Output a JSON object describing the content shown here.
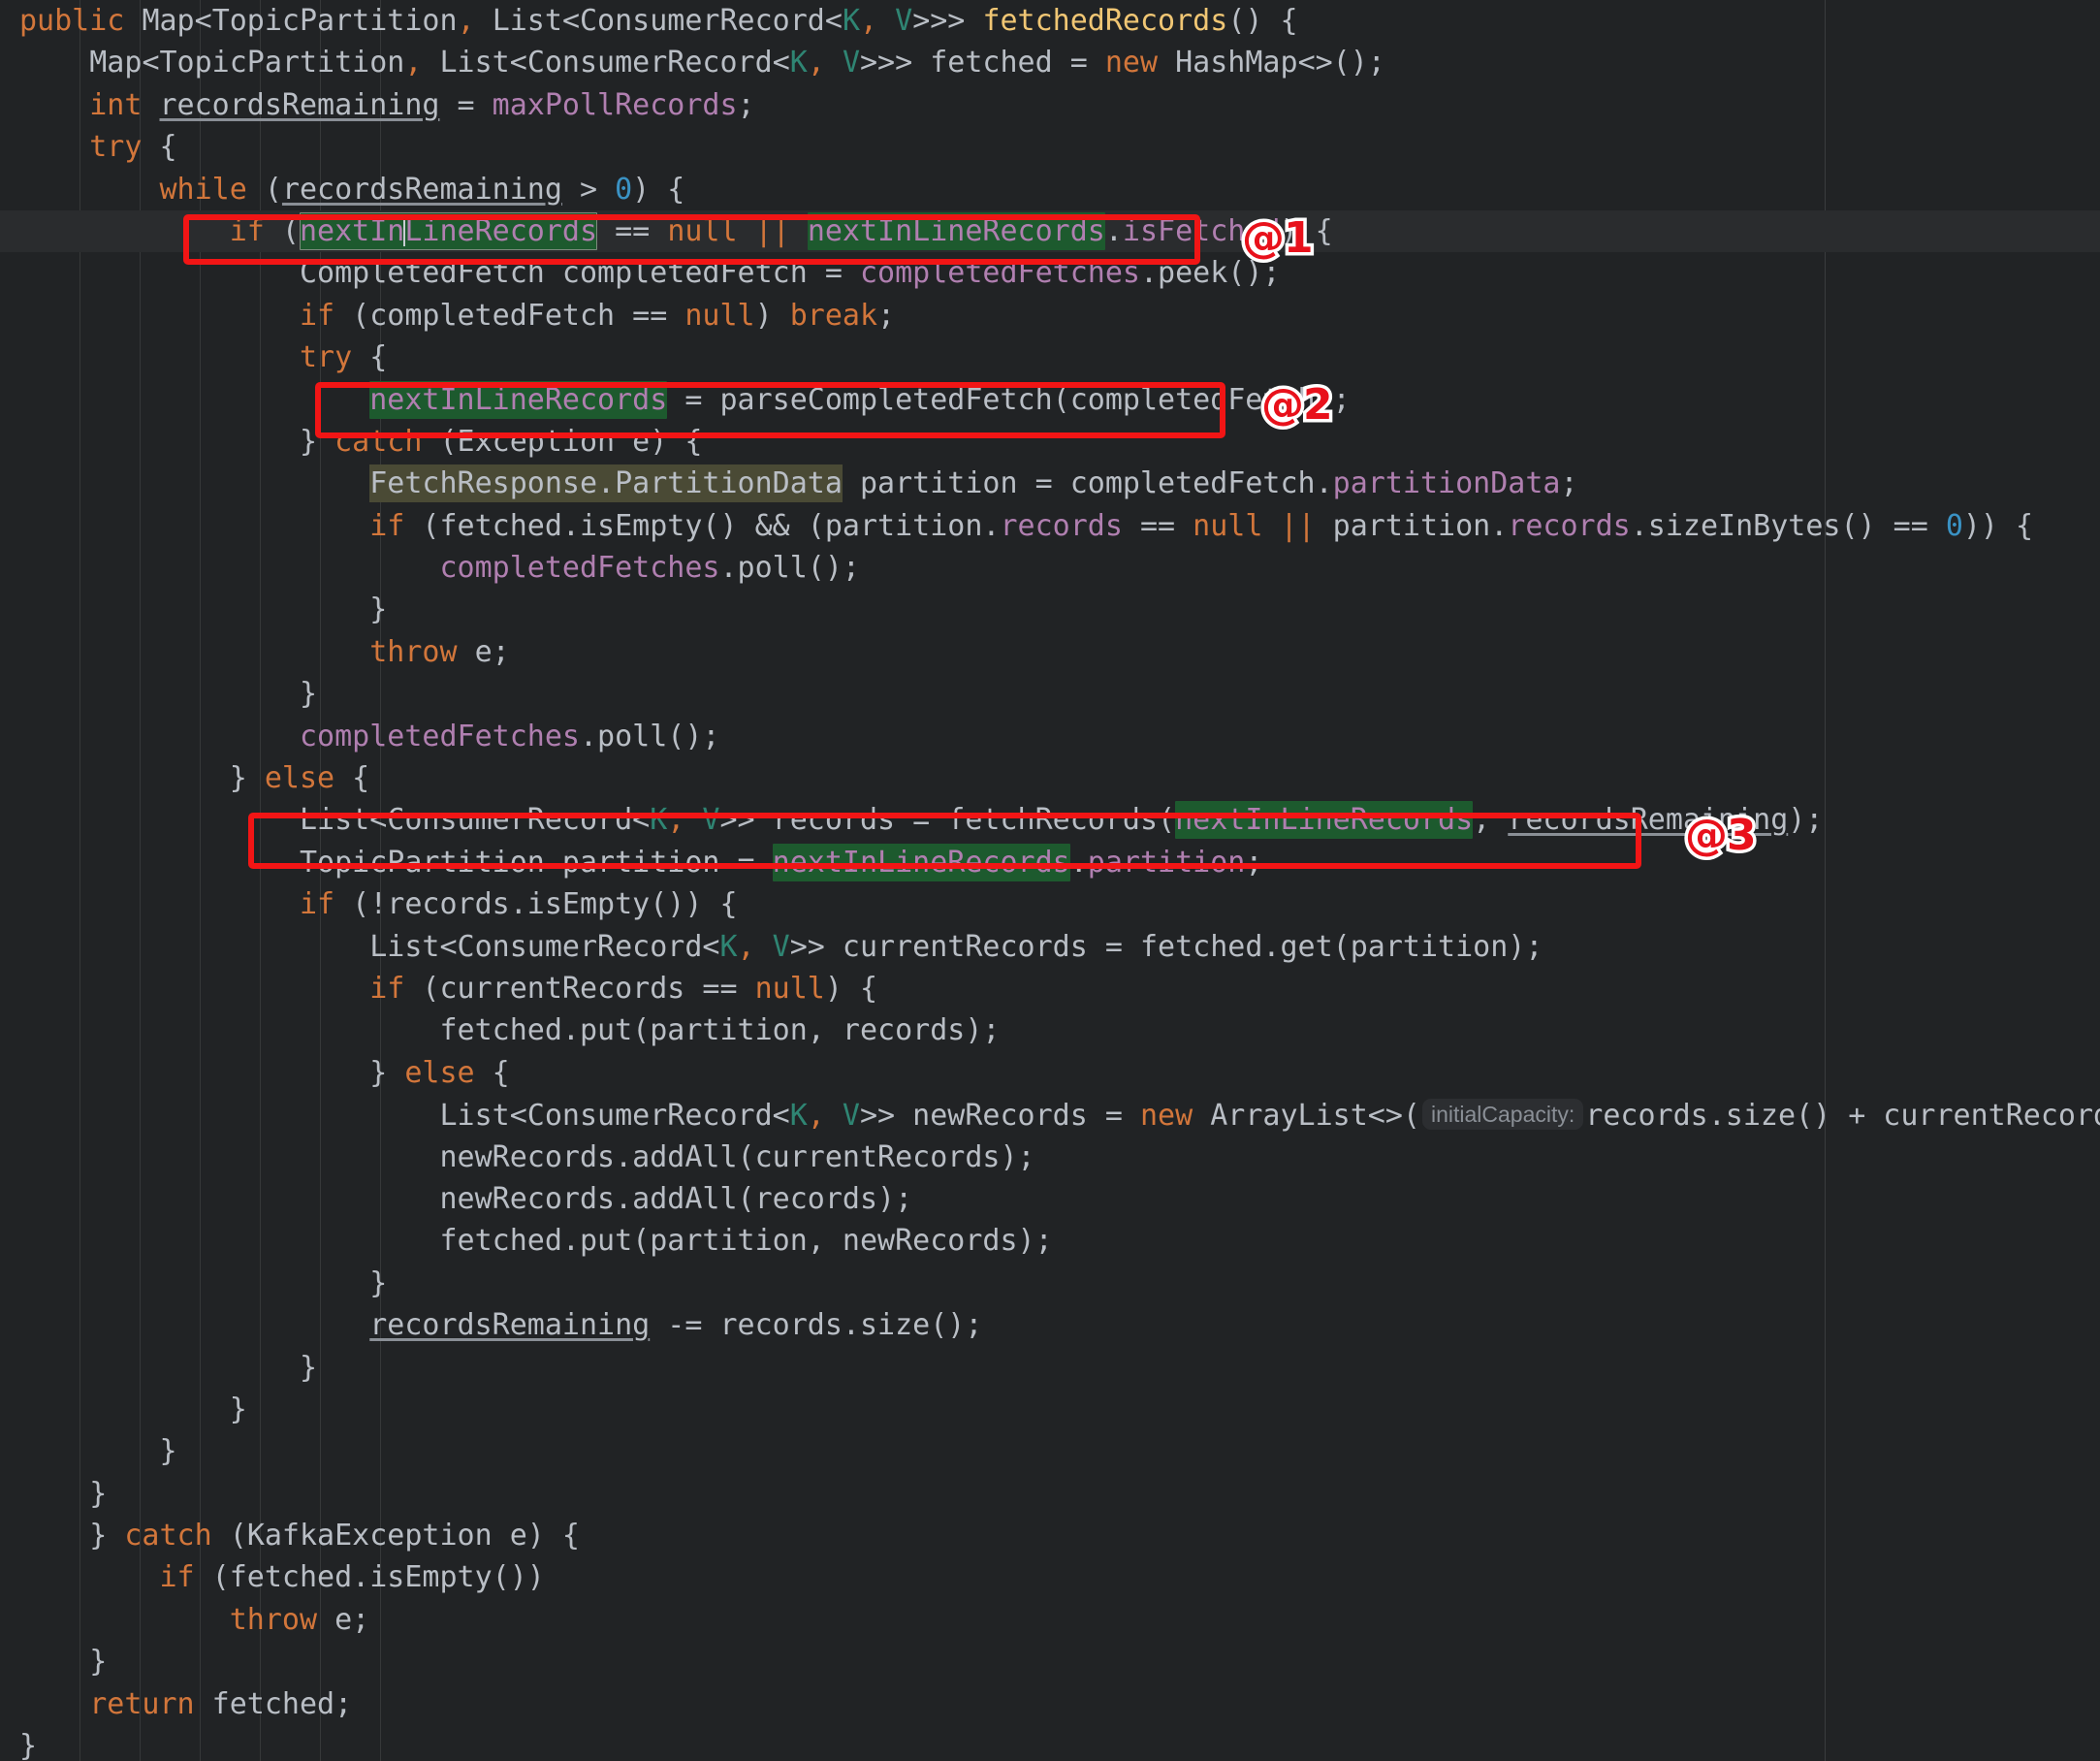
{
  "editor": {
    "language": "java",
    "theme": "darcula-dark",
    "background_color": "#212325",
    "current_line_color": "#2a2c2e",
    "occurrence_highlight_color": "#1d5a2e",
    "warning_highlight_color": "#4a4a35",
    "annotation_color": "#f21515",
    "inlay_hint_text": "initialCapacity:",
    "caret_visible": true
  },
  "annotations": [
    {
      "id": "annot-1",
      "label": "@1",
      "target_line": 6,
      "note": "if (nextInLineRecords == null || nextInLineRecords.isFetched) {"
    },
    {
      "id": "annot-2",
      "label": "@2",
      "target_line": 10,
      "note": "nextInLineRecords = parseCompletedFetch(completedFetch);"
    },
    {
      "id": "annot-3",
      "label": "@3",
      "target_line": 20,
      "note": "List<ConsumerRecord<K, V>> records = fetchRecords(nextInLineRecords, recordsRemaining);"
    }
  ],
  "code": {
    "method_name": "fetchedRecords",
    "return_type": "Map<TopicPartition, List<ConsumerRecord<K, V>>>",
    "highlighted_symbol": "nextInLineRecords",
    "lines": [
      "public Map<TopicPartition, List<ConsumerRecord<K, V>>> fetchedRecords() {",
      "    Map<TopicPartition, List<ConsumerRecord<K, V>>> fetched = new HashMap<>();",
      "    int recordsRemaining = maxPollRecords;",
      "    try {",
      "        while (recordsRemaining > 0) {",
      "            if (nextInLineRecords == null || nextInLineRecords.isFetched) {",
      "                CompletedFetch completedFetch = completedFetches.peek();",
      "                if (completedFetch == null) break;",
      "                try {",
      "                    nextInLineRecords = parseCompletedFetch(completedFetch);",
      "                } catch (Exception e) {",
      "                    FetchResponse.PartitionData partition = completedFetch.partitionData;",
      "                    if (fetched.isEmpty() && (partition.records == null || partition.records.sizeInBytes() == 0)) {",
      "                        completedFetches.poll();",
      "                    }",
      "                    throw e;",
      "                }",
      "                completedFetches.poll();",
      "            } else {",
      "                List<ConsumerRecord<K, V>> records = fetchRecords(nextInLineRecords, recordsRemaining);",
      "                TopicPartition partition = nextInLineRecords.partition;",
      "                if (!records.isEmpty()) {",
      "                    List<ConsumerRecord<K, V>> currentRecords = fetched.get(partition);",
      "                    if (currentRecords == null) {",
      "                        fetched.put(partition, records);",
      "                    } else {",
      "                        List<ConsumerRecord<K, V>> newRecords = new ArrayList<>( initialCapacity: records.size() + currentRecords.size());",
      "                        newRecords.addAll(currentRecords);",
      "                        newRecords.addAll(records);",
      "                        fetched.put(partition, newRecords);",
      "                    }",
      "                    recordsRemaining -= records.size();",
      "                }",
      "            }",
      "        }",
      "    }",
      "    } catch (KafkaException e) {",
      "        if (fetched.isEmpty())",
      "            throw e;",
      "    }",
      "    return fetched;",
      "}"
    ]
  }
}
